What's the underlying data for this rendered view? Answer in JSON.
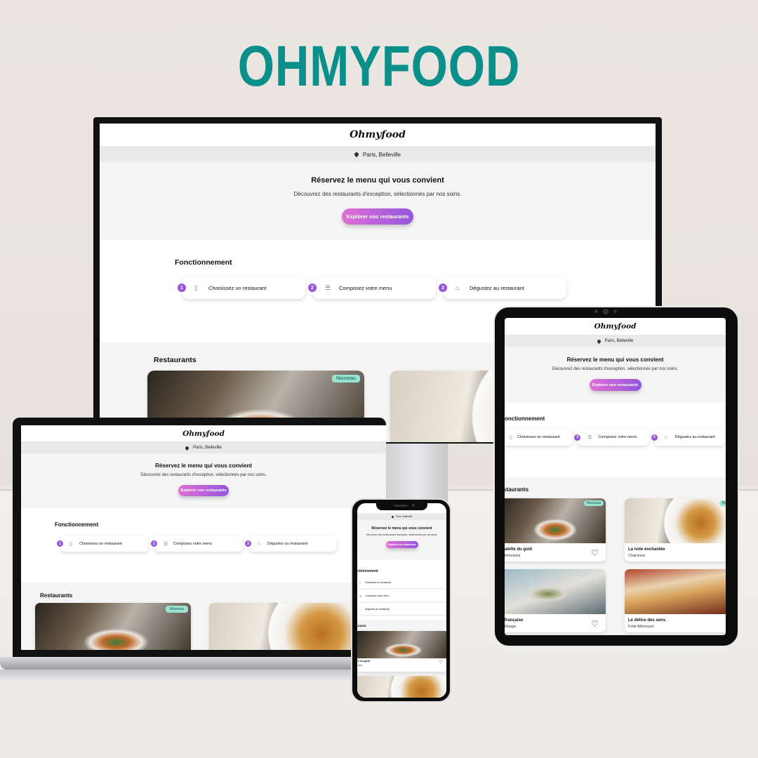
{
  "brand": {
    "title": "OHMYFOOD",
    "title_color": "#0b8f8a",
    "accent_gradient": [
      "#e06fd4",
      "#9356dc"
    ],
    "step_number_color": "#9356dc",
    "badge_bg": "#99e2d0"
  },
  "site": {
    "logo": "Ohmyfood",
    "location": "Paris, Belleville",
    "hero_title": "Réservez le menu qui vous convient",
    "hero_subtitle": "Découvrez des restaurants d'exception, sélectionnés par nos soins.",
    "cta_label": "Explorer nos restaurants",
    "how_title": "Fonctionnement",
    "steps": [
      {
        "number": "1",
        "icon": "phone-icon",
        "label": "Choisissez un restaurant"
      },
      {
        "number": "2",
        "icon": "list-icon",
        "label": "Composez votre menu"
      },
      {
        "number": "3",
        "icon": "store-icon",
        "label": "Dégustez au restaurant"
      }
    ],
    "restaurants_title": "Restaurants",
    "badge_label": "Nouveau",
    "restaurants": [
      {
        "name": "La palette du goût",
        "area": "Ménilmontant",
        "visible_name": "alette du goût",
        "visible_area": "ilmontant"
      },
      {
        "name": "La note enchantée",
        "area": "Charonne"
      },
      {
        "name": "À la française",
        "area": "Cité Rouge",
        "visible_name": "française",
        "visible_area": "Rouge"
      },
      {
        "name": "Le délice des sens",
        "area": "Folie-Méricourt"
      }
    ],
    "tablet_cropped": {
      "how_title": "onctionnement",
      "restaurants_title": "staurants",
      "badge_partial": "Nou"
    },
    "phone_cropped": {
      "how_title": "ctionnement",
      "restaurants_title": "urants",
      "rest1_name": "e du goût",
      "rest1_area": "tant"
    }
  }
}
